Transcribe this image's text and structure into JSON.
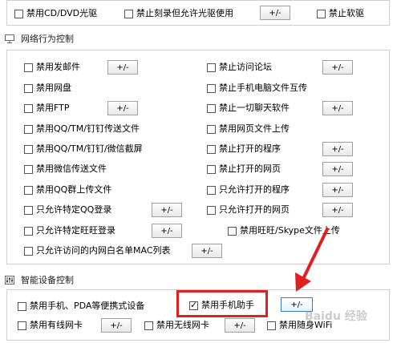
{
  "top_row": {
    "cd": "禁用CD/DVD光驱",
    "burn": "禁止刻录但允许光驱使用",
    "burn_btn": "+/-",
    "floppy": "禁止软驱"
  },
  "network": {
    "title": "网络行为控制",
    "left": [
      {
        "label": "禁用发邮件",
        "btn": "+/-"
      },
      {
        "label": "禁用网盘"
      },
      {
        "label": "禁用FTP",
        "btn": "+/-"
      },
      {
        "label": "禁用QQ/TM/钉钉传送文件"
      },
      {
        "label": "禁用QQ/TM/钉钉/微信截屏"
      },
      {
        "label": "禁用微信传送文件"
      },
      {
        "label": "禁用QQ群上传文件"
      },
      {
        "label": "只允许特定QQ登录",
        "btn": "+/-"
      },
      {
        "label": "只允许特定旺旺登录",
        "btn": "+/-"
      },
      {
        "label": "只允许访问的内网白名单MAC列表",
        "btn": "+/-"
      }
    ],
    "right": [
      {
        "label": "禁止访问论坛",
        "btn": "+/-"
      },
      {
        "label": "禁止手机电脑文件互传"
      },
      {
        "label": "禁止一切聊天软件",
        "btn": "+/-"
      },
      {
        "label": "禁用网页文件上传"
      },
      {
        "label": "禁止打开的程序",
        "btn": "+/-"
      },
      {
        "label": "禁止打开的网页",
        "btn": "+/-"
      },
      {
        "label": "只允许打开的程序",
        "btn": "+/-"
      },
      {
        "label": "只允许打开的网页",
        "btn": "+/-"
      },
      {
        "label": "禁用旺旺/Skype文件上传"
      }
    ]
  },
  "smart": {
    "title": "智能设备控制",
    "portable": "禁用手机、PDA等便携式设备",
    "assistant": "禁用手机助手",
    "assistant_btn": "+/-",
    "wired": "禁用有线网卡",
    "wired_btn": "+/-",
    "wireless": "禁用无线网卡",
    "wireless_btn": "+/-",
    "wifi": "禁用随身WiFi"
  },
  "watermark": "Baidu 经验",
  "colors": {
    "highlight_box": "#e02020",
    "arrow": "#e02020",
    "focus_button_border": "#3a7bd5"
  }
}
